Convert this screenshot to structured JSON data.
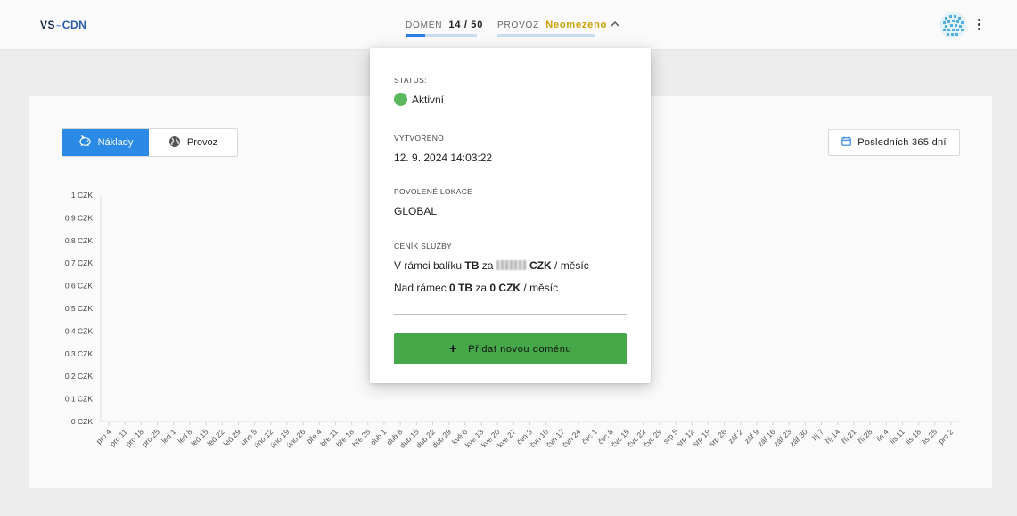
{
  "header": {
    "logo_vs": "VS",
    "logo_tilde": "~",
    "logo_cdn": "CDN",
    "domains": {
      "label": "DOMÉN",
      "used": "14",
      "sep": "/",
      "total": "50",
      "fill_fraction": 0.28
    },
    "traffic": {
      "label": "PROVOZ",
      "value": "Neomezeno"
    },
    "chevron_icon": "chevron-up-icon",
    "avatar_icon": "avatar",
    "menu_icon": "kebab-menu-icon"
  },
  "toolbar": {
    "costs_label": "Náklady",
    "costs_icon": "piggy-bank-icon",
    "traffic_label": "Provoz",
    "traffic_icon": "globe-icon",
    "range_label": "Posledních 365 dní",
    "range_icon": "calendar-icon"
  },
  "popover": {
    "status_label": "STATUS:",
    "status_value": "Aktivní",
    "status_color": "#5cb85c",
    "created_label": "VYTVOŘENO",
    "created_value": "12. 9. 2024 14:03:22",
    "locations_label": "POVOLENÉ LOKACE",
    "locations_value": "GLOBAL",
    "pricing_label": "CENÍK SLUŽBY",
    "line1_a": "V rámci balíku ",
    "line1_b": "TB",
    "line1_c": " za ",
    "line1_d": "CZK",
    "line1_e": " / měsíc",
    "line2_a": "Nad rámec ",
    "line2_b": "0 TB",
    "line2_c": " za ",
    "line2_d": "0 CZK",
    "line2_e": " / měsíc",
    "add_label": "Přidat novou doménu",
    "add_color": "#47a84a"
  },
  "colors": {
    "accent": "#2b8ae6",
    "traffic_value": "#c9a000",
    "success": "#47a84a"
  },
  "chart_data": {
    "type": "line",
    "title": "",
    "xlabel": "",
    "ylabel": "",
    "ylim": [
      0,
      1
    ],
    "yticks": [
      "0 CZK",
      "0.1 CZK",
      "0.2 CZK",
      "0.3 CZK",
      "0.4 CZK",
      "0.5 CZK",
      "0.6 CZK",
      "0.7 CZK",
      "0.8 CZK",
      "0.9 CZK",
      "1 CZK"
    ],
    "categories": [
      "pro 4",
      "pro 11",
      "pro 18",
      "pro 25",
      "led 1",
      "led 8",
      "led 15",
      "led 22",
      "led 29",
      "úno 5",
      "úno 12",
      "úno 19",
      "úno 26",
      "bře 4",
      "bře 11",
      "bře 18",
      "bře 25",
      "dub 1",
      "dub 8",
      "dub 15",
      "dub 22",
      "dub 29",
      "kvě 6",
      "kvě 13",
      "kvě 20",
      "kvě 27",
      "čvn 3",
      "čvn 10",
      "čvn 17",
      "čvn 24",
      "čvc 1",
      "čvc 8",
      "čvc 15",
      "čvc 22",
      "čvc 29",
      "srp 5",
      "srp 12",
      "srp 19",
      "srp 26",
      "zář 2",
      "zář 9",
      "zář 16",
      "zář 23",
      "zář 30",
      "říj 7",
      "říj 14",
      "říj 21",
      "říj 28",
      "lis 4",
      "lis 11",
      "lis 18",
      "lis 25",
      "pro 2"
    ],
    "series": [],
    "grid": false
  }
}
